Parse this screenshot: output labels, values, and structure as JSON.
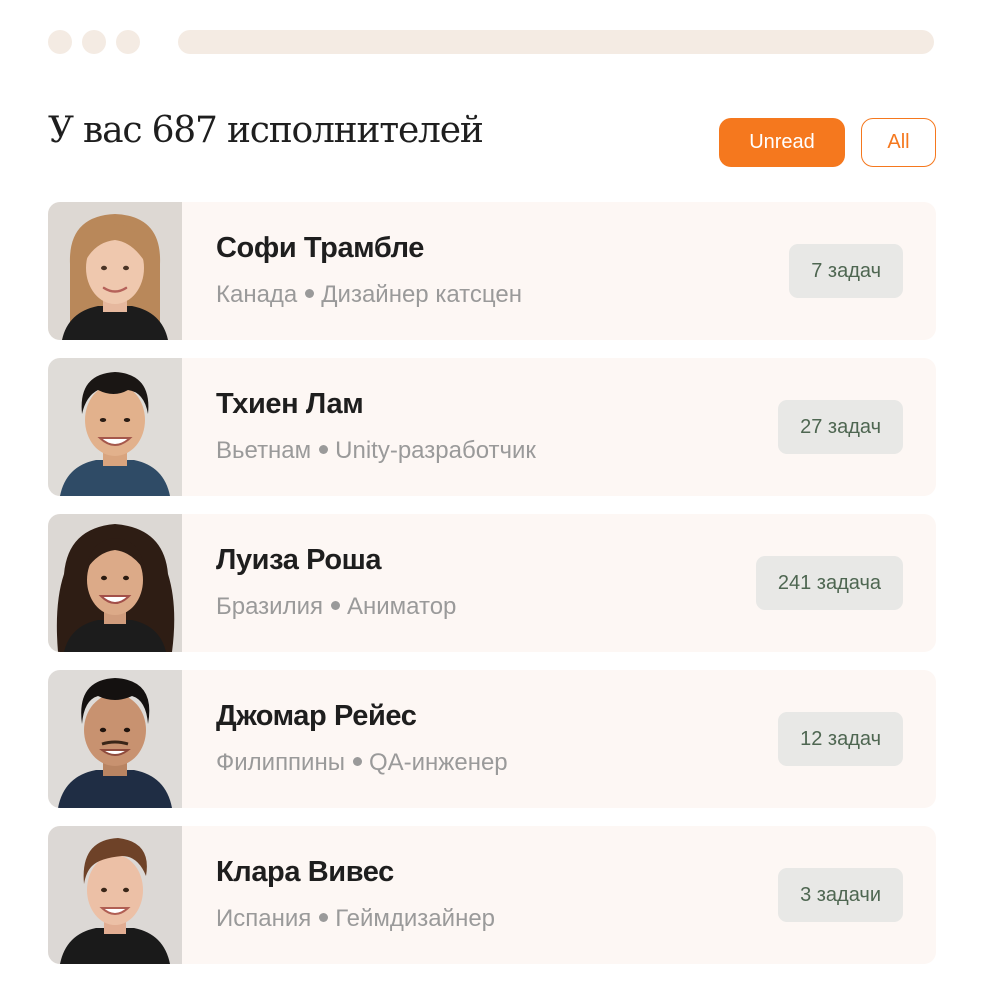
{
  "header": {
    "title": "У вас 687 исполнителей",
    "filters": {
      "unread_label": "Unread",
      "all_label": "All"
    }
  },
  "colors": {
    "accent": "#f5781e",
    "row_bg": "#fdf7f4",
    "badge_bg": "#e8e8e6",
    "badge_text": "#4e6651"
  },
  "performers": [
    {
      "name": "Софи Трамбле",
      "country": "Канада",
      "role": "Дизайнер катсцен",
      "tasks": "7 задач"
    },
    {
      "name": "Тхиен Лам",
      "country": "Вьетнам",
      "role": "Unity-разработчик",
      "tasks": "27 задач"
    },
    {
      "name": "Луиза Роша",
      "country": "Бразилия",
      "role": "Аниматор",
      "tasks": "241 задача"
    },
    {
      "name": "Джомар Рейес",
      "country": "Филиппины",
      "role": "QA-инженер",
      "tasks": "12 задач"
    },
    {
      "name": "Клара Вивес",
      "country": "Испания",
      "role": "Геймдизайнер",
      "tasks": "3 задачи"
    }
  ]
}
